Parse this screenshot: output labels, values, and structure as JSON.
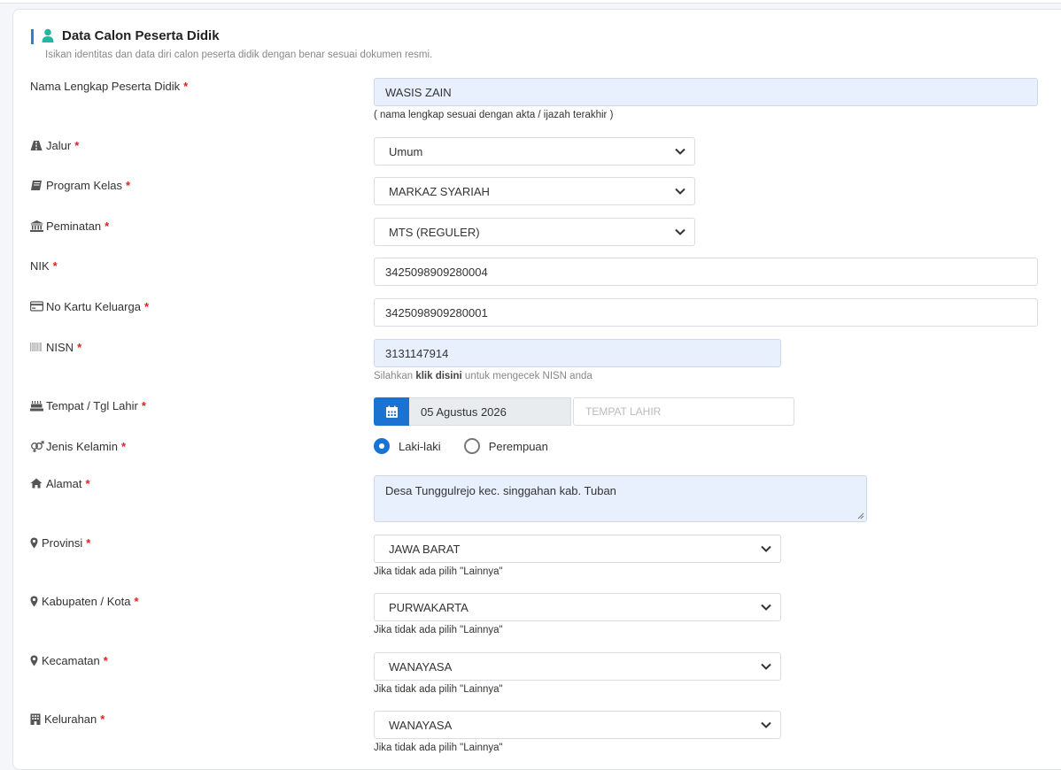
{
  "section": {
    "title": "Data Calon Peserta Didik",
    "description": "Isikan identitas dan data diri calon peserta didik dengan benar sesuai dokumen resmi."
  },
  "fields": {
    "nama": {
      "label": "Nama Lengkap Peserta Didik",
      "value": "WASIS ZAIN",
      "hint": "( nama lengkap sesuai dengan akta / ijazah terakhir )"
    },
    "jalur": {
      "label": "Jalur",
      "value": "Umum",
      "icon": "road-icon"
    },
    "program_kelas": {
      "label": "Program Kelas",
      "value": "MARKAZ SYARIAH",
      "icon": "book-icon"
    },
    "peminatan": {
      "label": "Peminatan",
      "value": "MTS (REGULER)",
      "icon": "institution-icon"
    },
    "nik": {
      "label": "NIK",
      "value": "3425098909280004"
    },
    "no_kk": {
      "label": "No Kartu Keluarga",
      "value": "3425098909280001",
      "icon": "credit-card-icon"
    },
    "nisn": {
      "label": "NISN",
      "value": "3131147914",
      "icon": "barcode-icon",
      "hint_prefix": "Silahkan ",
      "hint_link": "klik disini",
      "hint_suffix": " untuk mengecek NISN anda"
    },
    "ttl": {
      "label": "Tempat / Tgl Lahir",
      "date": "05 Agustus 2026",
      "place_placeholder": "TEMPAT LAHIR",
      "icon": "birthday-cake-icon"
    },
    "jenis_kelamin": {
      "label": "Jenis Kelamin",
      "options": [
        "Laki-laki",
        "Perempuan"
      ],
      "selected": "Laki-laki",
      "icon": "venus-mars-icon"
    },
    "alamat": {
      "label": "Alamat",
      "value": "Desa Tunggulrejo kec. singgahan kab. Tuban",
      "icon": "home-icon"
    },
    "provinsi": {
      "label": "Provinsi",
      "value": "JAWA BARAT",
      "hint": "Jika tidak ada pilih \"Lainnya\"",
      "icon": "map-marker-icon"
    },
    "kabupaten": {
      "label": "Kabupaten / Kota",
      "value": "PURWAKARTA",
      "hint": "Jika tidak ada pilih \"Lainnya\"",
      "icon": "map-marker-icon"
    },
    "kecamatan": {
      "label": "Kecamatan",
      "value": "WANAYASA",
      "hint": "Jika tidak ada pilih \"Lainnya\"",
      "icon": "map-marker-icon"
    },
    "kelurahan": {
      "label": "Kelurahan",
      "value": "WANAYASA",
      "hint": "Jika tidak ada pilih \"Lainnya\"",
      "icon": "building-icon"
    }
  },
  "required_mark": "*",
  "colors": {
    "primary": "#1a73d1",
    "accent_icon": "#22b8a0",
    "required": "#e02020",
    "autofill_bg": "#e8f0fe"
  }
}
